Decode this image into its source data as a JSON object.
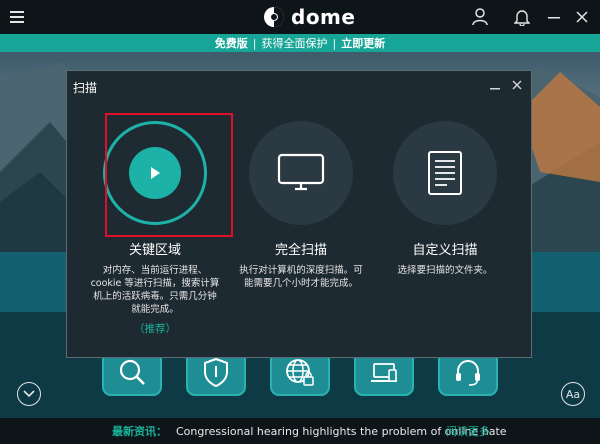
{
  "app": {
    "name": "dome"
  },
  "promo": {
    "edition": "免费版",
    "offer": "获得全面保护",
    "upgrade": "立即更新"
  },
  "dialog": {
    "title": "扫描",
    "options": [
      {
        "title": "关键区域",
        "description": "对内存、当前运行进程、cookie 等进行扫描，搜索计算机上的活跃病毒。只需几分钟就能完成。",
        "recommended": "（推荐）",
        "selected": true,
        "icon": "play-icon"
      },
      {
        "title": "完全扫描",
        "description": "执行对计算机的深度扫描。可能需要几个小时才能完成。",
        "icon": "monitor-icon"
      },
      {
        "title": "自定义扫描",
        "description": "选择要扫描的文件夹。",
        "icon": "document-icon"
      }
    ]
  },
  "shortcuts": [
    {
      "icon": "search-icon"
    },
    {
      "icon": "shield-icon"
    },
    {
      "icon": "globe-lock-icon"
    },
    {
      "icon": "devices-icon"
    },
    {
      "icon": "headset-icon"
    }
  ],
  "news": {
    "label": "最新资讯：",
    "headline": "Congressional hearing highlights the problem of online hate",
    "more": "阅读更多"
  },
  "font_button": {
    "label": "Aa"
  },
  "colors": {
    "accent": "#1db2a8",
    "promo_bar": "#16a596",
    "highlight": "#e0102b",
    "dialog_bg": "#1e2a31",
    "titlebar_bg": "#0e1519"
  }
}
